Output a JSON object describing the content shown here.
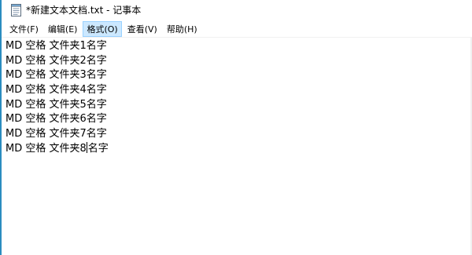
{
  "window": {
    "title": "*新建文本文档.txt - 记事本",
    "icon": "notepad-icon"
  },
  "menu": {
    "items": [
      {
        "label": "文件(F)"
      },
      {
        "label": "编辑(E)"
      },
      {
        "label": "格式(O)",
        "active": true
      },
      {
        "label": "查看(V)"
      },
      {
        "label": "帮助(H)"
      }
    ]
  },
  "document": {
    "lines": [
      "MD 空格 文件夹1名字",
      "MD 空格 文件夹2名字",
      "MD 空格 文件夹3名字",
      "MD 空格 文件夹4名字",
      "MD 空格 文件夹5名字",
      "MD 空格 文件夹6名字",
      "MD 空格 文件夹7名字"
    ],
    "last_line_before_caret": "MD 空格 文件夹8",
    "last_line_after_caret": "名字"
  },
  "colors": {
    "menu_active_bg": "#cce8ff",
    "menu_active_border": "#99d1ff",
    "window_edge": "#2b8cbf"
  }
}
